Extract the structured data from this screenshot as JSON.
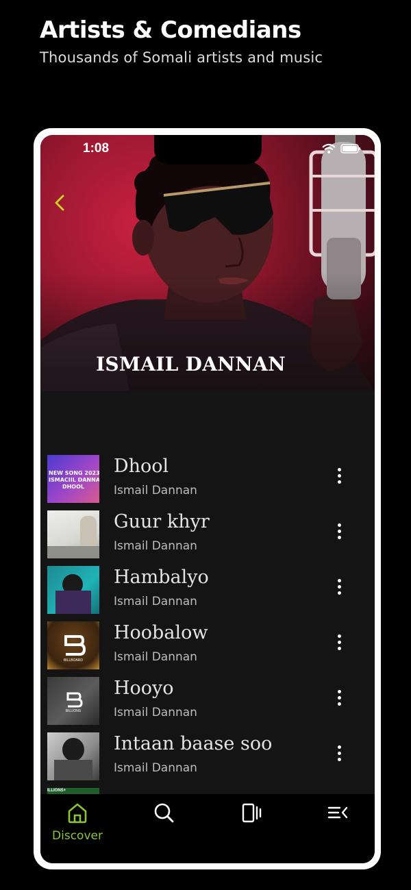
{
  "promo": {
    "title": "Artists & Comedians",
    "subtitle": "Thousands of Somali artists and music"
  },
  "status_bar": {
    "time": "1:08"
  },
  "artist": {
    "name": "ISMAIL DANNAN"
  },
  "tracks": [
    {
      "title": "Dhool",
      "artist": "Ismail Dannan",
      "thumb_text": "NEW SONG 2023\nISMACIIL DANNAN\nDHOOL"
    },
    {
      "title": "Guur khyr",
      "artist": "Ismail Dannan"
    },
    {
      "title": "Hambalyo",
      "artist": "Ismail Dannan"
    },
    {
      "title": "Hoobalow",
      "artist": "Ismail Dannan",
      "thumb_text": "BILLBOARD"
    },
    {
      "title": "Hooyo",
      "artist": "Ismail Dannan",
      "thumb_text": "BILLIONS"
    },
    {
      "title": "Intaan baase soo",
      "artist": "Ismail Dannan"
    }
  ],
  "partial_thumb_text": "ILLIONS+",
  "nav": {
    "items": [
      {
        "label": "Discover",
        "icon": "home-icon",
        "active": true
      },
      {
        "label": "",
        "icon": "search-icon",
        "active": false
      },
      {
        "label": "",
        "icon": "library-icon",
        "active": false
      },
      {
        "label": "",
        "icon": "queue-icon",
        "active": false
      }
    ]
  },
  "colors": {
    "accent": "#8cc43a",
    "back_arrow": "#c9d21f",
    "background": "#141414",
    "hero_red": "#c8213f"
  }
}
